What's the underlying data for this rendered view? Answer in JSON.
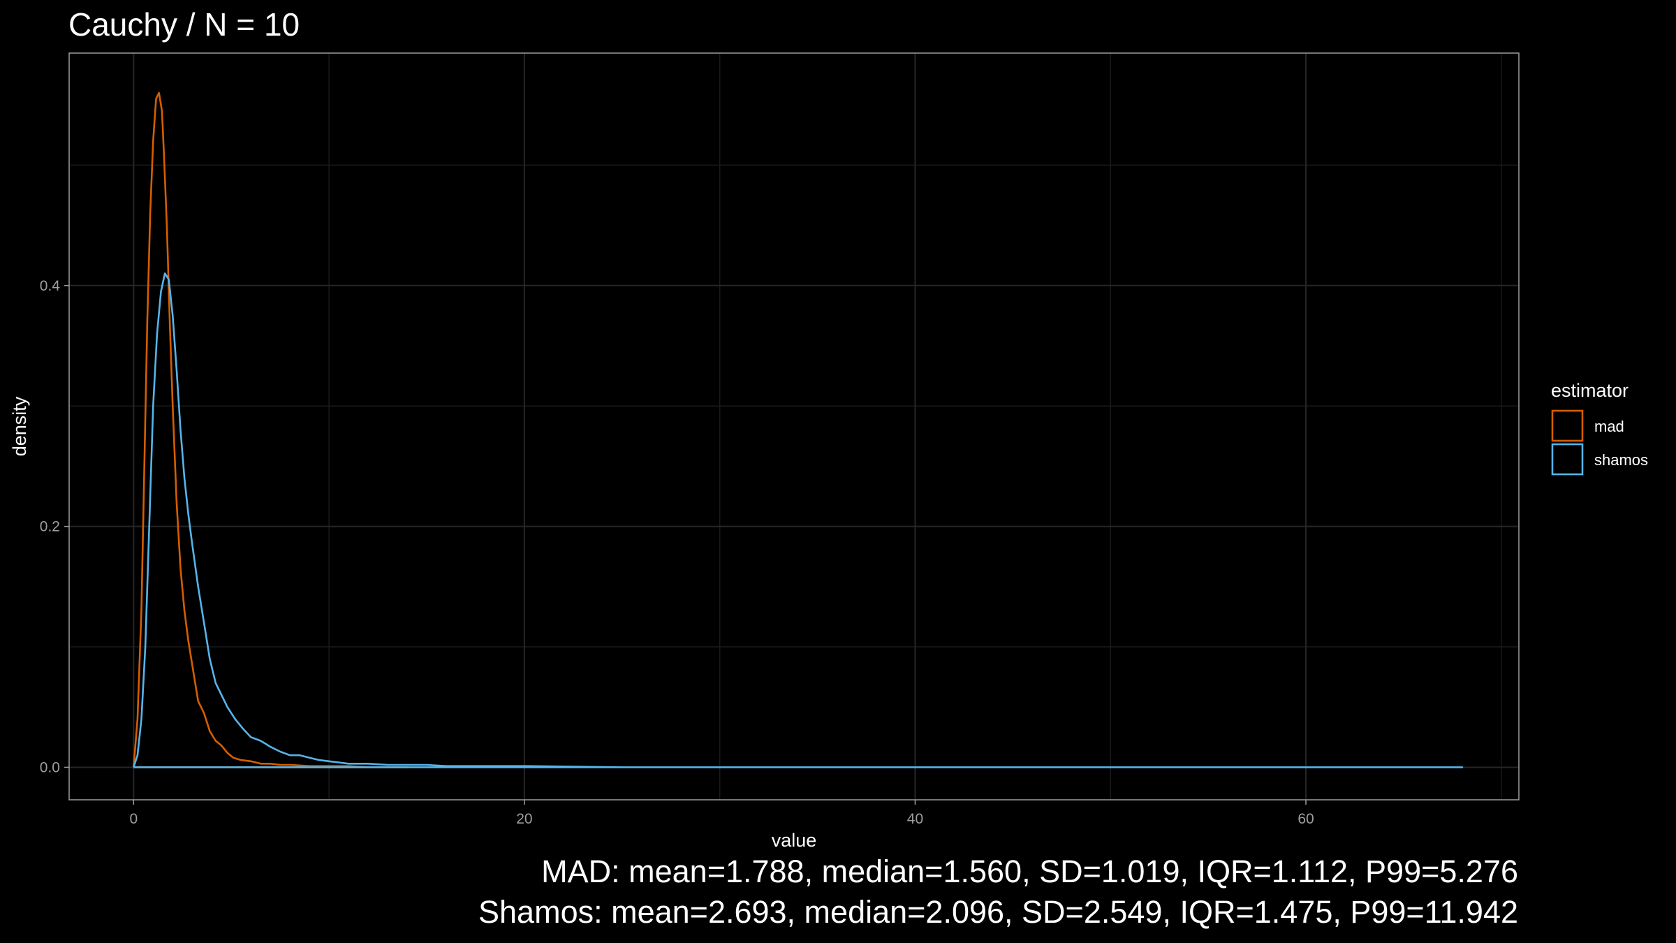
{
  "chart_data": {
    "type": "line",
    "title": "Cauchy / N = 10",
    "xlabel": "value",
    "ylabel": "density",
    "xlim": [
      -3.3,
      70.9
    ],
    "ylim": [
      -0.027,
      0.593
    ],
    "xticks": [
      0,
      20,
      40,
      60
    ],
    "yticks": [
      0.0,
      0.2,
      0.4
    ],
    "xtick_labels": [
      "0",
      "20",
      "40",
      "60"
    ],
    "ytick_labels": [
      "0.0",
      "0.2",
      "0.4"
    ],
    "grid": true,
    "legend": {
      "title": "estimator",
      "position": "right"
    },
    "series": [
      {
        "name": "mad",
        "color": "#d55e00",
        "x": [
          0.0,
          0.2,
          0.4,
          0.55,
          0.7,
          0.85,
          1.0,
          1.15,
          1.3,
          1.45,
          1.55,
          1.7,
          1.85,
          2.0,
          2.2,
          2.4,
          2.6,
          2.8,
          3.0,
          3.3,
          3.6,
          3.9,
          4.2,
          4.5,
          4.8,
          5.1,
          5.5,
          6.0,
          6.5,
          7.0,
          7.5,
          8.0,
          9.0,
          10.0,
          11.0,
          12.0,
          13.0,
          14.0
        ],
        "y": [
          0.0,
          0.04,
          0.13,
          0.25,
          0.37,
          0.46,
          0.52,
          0.555,
          0.56,
          0.545,
          0.51,
          0.45,
          0.37,
          0.3,
          0.22,
          0.165,
          0.13,
          0.105,
          0.085,
          0.055,
          0.045,
          0.03,
          0.022,
          0.018,
          0.012,
          0.008,
          0.006,
          0.005,
          0.003,
          0.003,
          0.002,
          0.002,
          0.001,
          0.001,
          0.001,
          0.0,
          0.0,
          0.0
        ]
      },
      {
        "name": "shamos",
        "color": "#56b4e9",
        "x": [
          0.0,
          0.2,
          0.4,
          0.6,
          0.8,
          1.0,
          1.2,
          1.4,
          1.6,
          1.8,
          2.0,
          2.2,
          2.4,
          2.6,
          2.8,
          3.0,
          3.3,
          3.6,
          3.9,
          4.2,
          4.5,
          4.8,
          5.2,
          5.6,
          6.0,
          6.5,
          7.0,
          7.5,
          8.0,
          8.5,
          9.0,
          9.5,
          10.0,
          10.5,
          11.0,
          12.0,
          13.0,
          14.0,
          15.0,
          16.0,
          18.0,
          20.0,
          25.0,
          30.0,
          40.0,
          50.0,
          60.0,
          68.0
        ],
        "y": [
          0.0,
          0.01,
          0.04,
          0.1,
          0.2,
          0.3,
          0.36,
          0.395,
          0.41,
          0.405,
          0.375,
          0.33,
          0.28,
          0.24,
          0.21,
          0.185,
          0.15,
          0.12,
          0.09,
          0.07,
          0.06,
          0.05,
          0.04,
          0.032,
          0.025,
          0.022,
          0.017,
          0.013,
          0.01,
          0.01,
          0.008,
          0.006,
          0.005,
          0.004,
          0.003,
          0.003,
          0.002,
          0.002,
          0.002,
          0.001,
          0.001,
          0.001,
          0.0,
          0.0,
          0.0,
          0.0,
          0.0,
          0.0
        ]
      }
    ],
    "captions": [
      "MAD: mean=1.788, median=1.560, SD=1.019, IQR=1.112, P99=5.276",
      "Shamos: mean=2.693, median=2.096, SD=2.549, IQR=1.475, P99=11.942"
    ]
  }
}
